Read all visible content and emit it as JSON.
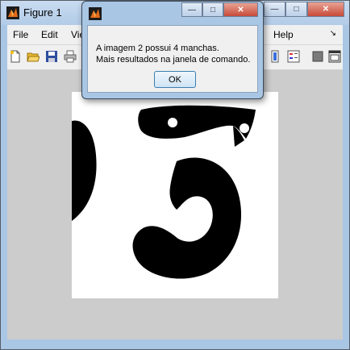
{
  "figure": {
    "title": "Figure 1",
    "menus": [
      "File",
      "Edit",
      "Vie",
      "Help"
    ],
    "toolbar_icons": [
      "new-figure-icon",
      "open-file-icon",
      "save-icon",
      "print-icon",
      "insert-colorbar-icon",
      "insert-legend-icon",
      "hide-plot-tools-icon",
      "show-plot-tools-icon"
    ]
  },
  "dialog": {
    "line1": "A imagem 2 possui 4 manchas.",
    "line2": "Mais resultados na janela de comando.",
    "ok_label": "OK"
  },
  "caption_buttons": {
    "minimize": "—",
    "maximize": "□",
    "close": "✕"
  },
  "colors": {
    "titlebar": "#a9c6e4",
    "canvas_bg": "#cccccc",
    "close_button": "#c74a38"
  }
}
